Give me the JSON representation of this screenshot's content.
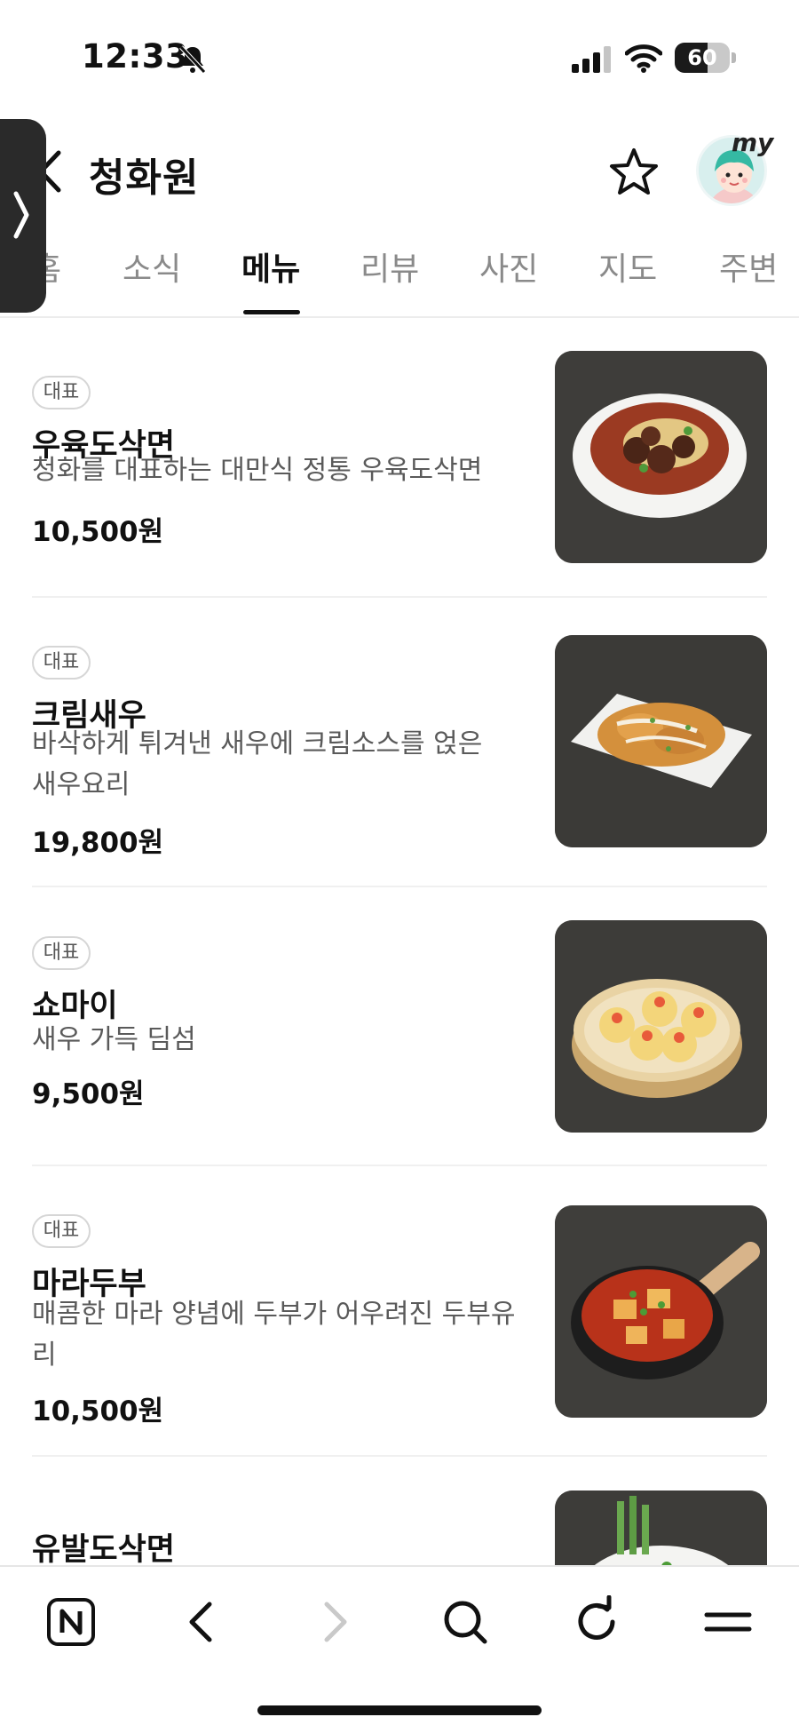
{
  "status_bar": {
    "time": "12:33",
    "battery_level": "60"
  },
  "header": {
    "title": "청화원",
    "avatar_badge": "my"
  },
  "tabs": [
    "홈",
    "소식",
    "메뉴",
    "리뷰",
    "사진",
    "지도",
    "주변"
  ],
  "active_tab": "메뉴",
  "menu": {
    "items": [
      {
        "badge": "대표",
        "name": "우육도삭면",
        "description": "청화를 대표하는 대만식 정통 우육도삭면",
        "price": "10,500원",
        "photo": "noodle-soup-photo"
      },
      {
        "badge": "대표",
        "name": "크림새우",
        "description": "바삭하게 튀겨낸 새우에 크림소스를 얹은 새우요리",
        "price": "19,800원",
        "photo": "cream-shrimp-photo"
      },
      {
        "badge": "대표",
        "name": "쇼마이",
        "description": "새우 가득 딤섬",
        "price": "9,500원",
        "photo": "shumai-photo"
      },
      {
        "badge": "대표",
        "name": "마라두부",
        "description": "매콤한 마라 양념에 두부가 어우려진 두부유리",
        "price": "10,500원",
        "photo": "mala-tofu-photo"
      },
      {
        "badge": "",
        "name": "유발도삭면",
        "description": "",
        "price": "",
        "photo": "yubal-noodle-photo"
      }
    ]
  },
  "bottom_nav": [
    "naver-home-icon",
    "back-icon",
    "forward-icon",
    "search-icon",
    "refresh-icon",
    "menu-icon"
  ]
}
